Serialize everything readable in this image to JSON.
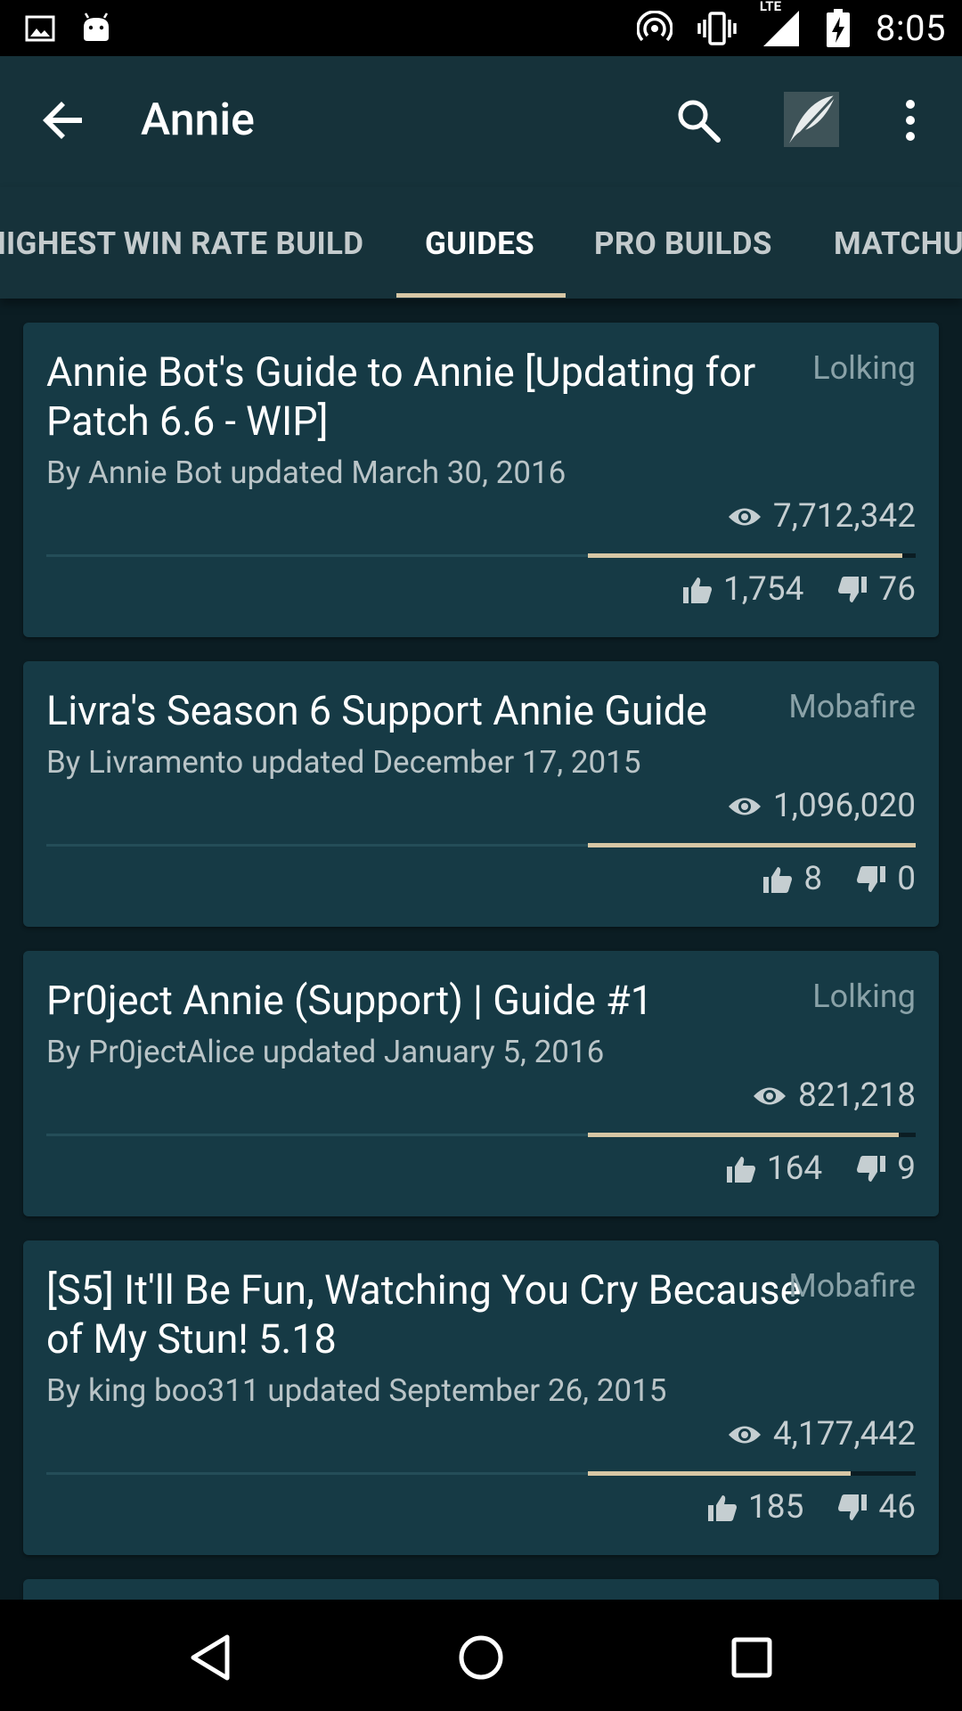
{
  "status_bar": {
    "time": "8:05",
    "network": "LTE",
    "icons": [
      "image-icon",
      "android-icon",
      "hotspot-icon",
      "vibrate-icon",
      "signal-icon",
      "battery-charging-icon"
    ]
  },
  "app_bar": {
    "title": "Annie",
    "icons": [
      "back-arrow-icon",
      "search-icon",
      "champion-avatar-icon",
      "more-vert-icon"
    ]
  },
  "tabs": [
    {
      "label": "HIGHEST WIN RATE BUILD",
      "active": false
    },
    {
      "label": "GUIDES",
      "active": true
    },
    {
      "label": "PRO BUILDS",
      "active": false
    },
    {
      "label": "MATCHUPS",
      "active": false
    }
  ],
  "guides": [
    {
      "title": "Annie Bot's Guide to Annie [Updating for Patch 6.6 - WIP]",
      "source": "Lolking",
      "byline": "By Annie Bot updated March 30, 2016",
      "views": "7,712,342",
      "upvotes": "1,754",
      "downvotes": "76",
      "rating": 0.958
    },
    {
      "title": "Livra's Season 6 Support Annie Guide",
      "source": "Mobafire",
      "byline": "By Livramento updated December 17, 2015",
      "views": "1,096,020",
      "upvotes": "8",
      "downvotes": "0",
      "rating": 1.0
    },
    {
      "title": "Pr0ject Annie (Support) | Guide #1",
      "source": "Lolking",
      "byline": "By Pr0jectAlice updated January 5, 2016",
      "views": "821,218",
      "upvotes": "164",
      "downvotes": "9",
      "rating": 0.948
    },
    {
      "title": "[S5] It'll Be Fun, Watching You Cry Because of My Stun! 5.18",
      "source": "Mobafire",
      "byline": "By king boo311 updated September 26, 2015",
      "views": "4,177,442",
      "upvotes": "185",
      "downvotes": "46",
      "rating": 0.801
    }
  ],
  "nav_bar": {
    "icons": [
      "nav-back-icon",
      "nav-home-icon",
      "nav-recents-icon"
    ]
  },
  "colors": {
    "background": "#0b1d23",
    "app_bar": "#16323a",
    "card": "#163a45",
    "accent": "#d7c7a5"
  }
}
